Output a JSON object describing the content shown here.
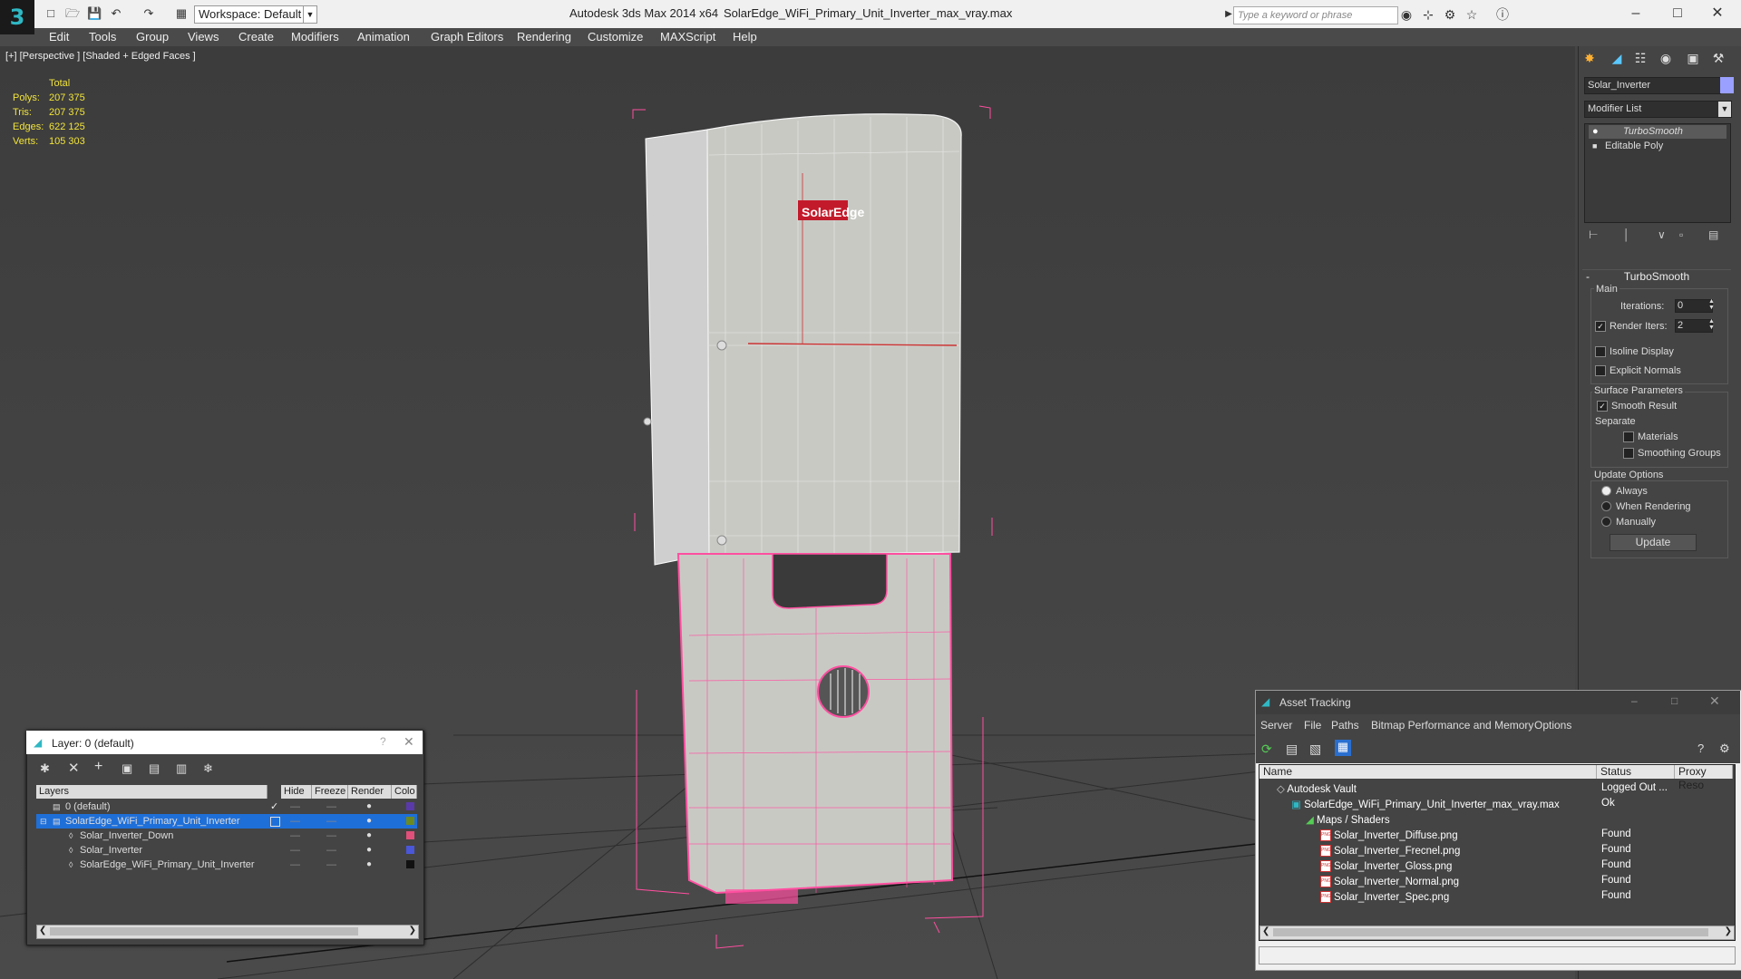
{
  "titlebar": {
    "workspace": "Workspace: Default",
    "app_title": "Autodesk 3ds Max  2014 x64",
    "doc_title": "SolarEdge_WiFi_Primary_Unit_Inverter_max_vray.max",
    "search_placeholder": "Type a keyword or phrase"
  },
  "menu": [
    "Edit",
    "Tools",
    "Group",
    "Views",
    "Create",
    "Modifiers",
    "Animation",
    "Graph Editors",
    "Rendering",
    "Customize",
    "MAXScript",
    "Help"
  ],
  "viewport": {
    "label": "[+] [Perspective ] [Shaded + Edged Faces ]",
    "stats": {
      "header": "Total",
      "polys_label": "Polys:",
      "polys": "207 375",
      "tris_label": "Tris:",
      "tris": "207 375",
      "edges_label": "Edges:",
      "edges": "622 125",
      "verts_label": "Verts:",
      "verts": "105 303"
    },
    "model_logo": "SolarEdge"
  },
  "command_panel": {
    "object_name": "Solar_Inverter",
    "object_color": "#9aa0ff",
    "modifier_list": "Modifier List",
    "stack": [
      "TurboSmooth",
      "Editable Poly"
    ],
    "rollout_title": "TurboSmooth",
    "main_label": "Main",
    "iterations_label": "Iterations:",
    "iterations": "0",
    "render_iters_label": "Render Iters:",
    "render_iters": "2",
    "isoline": "Isoline Display",
    "explicit_normals": "Explicit Normals",
    "surface_params": "Surface Parameters",
    "smooth_result": "Smooth Result",
    "separate": "Separate",
    "materials": "Materials",
    "smoothing_groups": "Smoothing Groups",
    "update_options": "Update Options",
    "always": "Always",
    "when_rendering": "When Rendering",
    "manually": "Manually",
    "update_button": "Update"
  },
  "layer_dialog": {
    "title": "Layer: 0 (default)",
    "columns": [
      "Layers",
      "Hide",
      "Freeze",
      "Render",
      "Colo"
    ],
    "rows": [
      {
        "name": "0 (default)",
        "color": "#5a3aa8"
      },
      {
        "name": "SolarEdge_WiFi_Primary_Unit_Inverter",
        "color": "#6b8a22"
      },
      {
        "name": "Solar_Inverter_Down",
        "color": "#e0507a"
      },
      {
        "name": "Solar_Inverter",
        "color": "#4a57d8"
      },
      {
        "name": "SolarEdge_WiFi_Primary_Unit_Inverter",
        "color": "#111111"
      }
    ]
  },
  "asset_tracking": {
    "title": "Asset Tracking",
    "menu": [
      "Server",
      "File",
      "Paths",
      "Bitmap Performance and Memory",
      "Options"
    ],
    "columns": [
      "Name",
      "Status",
      "Proxy Reso"
    ],
    "rows": [
      {
        "name": "Autodesk Vault",
        "status": "Logged Out ..."
      },
      {
        "name": "SolarEdge_WiFi_Primary_Unit_Inverter_max_vray.max",
        "status": "Ok"
      },
      {
        "name": "Maps / Shaders",
        "status": ""
      },
      {
        "name": "Solar_Inverter_Diffuse.png",
        "status": "Found"
      },
      {
        "name": "Solar_Inverter_Frecnel.png",
        "status": "Found"
      },
      {
        "name": "Solar_Inverter_Gloss.png",
        "status": "Found"
      },
      {
        "name": "Solar_Inverter_Normal.png",
        "status": "Found"
      },
      {
        "name": "Solar_Inverter_Spec.png",
        "status": "Found"
      }
    ]
  }
}
